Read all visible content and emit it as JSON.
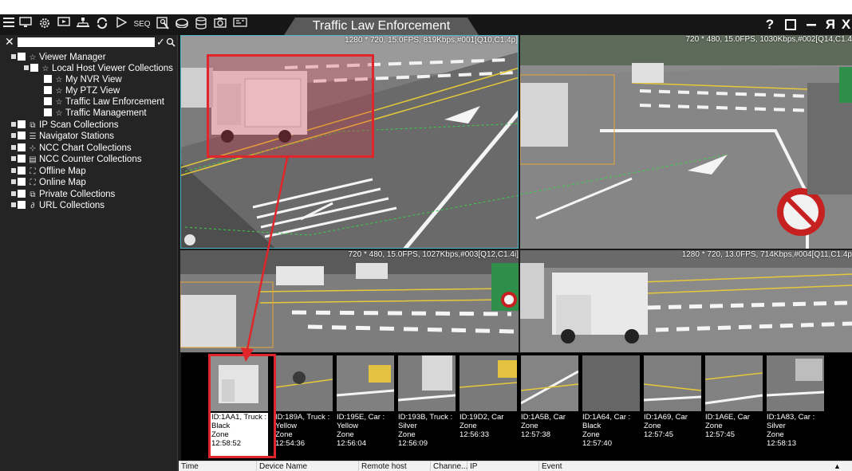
{
  "toolbar": {
    "icons": [
      "hamburger-menu-icon",
      "monitor-icon",
      "gear-icon",
      "display-icon",
      "network-icon",
      "refresh-icon",
      "play-icon",
      "sequence-icon",
      "map-pin-icon",
      "storage-icon",
      "database-icon",
      "snapshot-icon",
      "capture-icon"
    ],
    "seq_label": "SEQ"
  },
  "window": {
    "title": "Traffic Law Enforcement",
    "help": "?",
    "maximize": "☐",
    "minimize": "−",
    "user": "Я",
    "close": "X"
  },
  "sidebar": {
    "search_placeholder": "",
    "tree": [
      {
        "label": "Viewer Manager",
        "icon": "star-icon"
      },
      {
        "label": "Local Host Viewer Collections",
        "icon": "star-icon"
      },
      {
        "label": "My NVR View",
        "icon": "star-icon"
      },
      {
        "label": "My PTZ View",
        "icon": "star-icon"
      },
      {
        "label": "Traffic Law Enforcement",
        "icon": "star-icon"
      },
      {
        "label": "Traffic Management",
        "icon": "star-icon"
      },
      {
        "label": "IP Scan Collections",
        "icon": "ip-scan-icon"
      },
      {
        "label": "Navigator Stations",
        "icon": "station-icon"
      },
      {
        "label": "NCC Chart Collections",
        "icon": "chart-icon"
      },
      {
        "label": "NCC Counter Collections",
        "icon": "counter-icon"
      },
      {
        "label": "Offline Map",
        "icon": "map-icon"
      },
      {
        "label": "Online Map",
        "icon": "map-icon"
      },
      {
        "label": "Private Collections",
        "icon": "private-icon"
      },
      {
        "label": "URL Collections",
        "icon": "link-icon"
      }
    ]
  },
  "cameras": [
    {
      "info": "1280 * 720, 15.0FPS, 819Kbps,#001[Q10,C1.4p]"
    },
    {
      "info": "720 * 480, 15.0FPS, 1030Kbps,#002[Q14,C1.4"
    },
    {
      "info": "720 * 480, 15.0FPS, 1027Kbps,#003[Q12,C1.4i]"
    },
    {
      "info": "1280 * 720, 13.0FPS, 714Kbps,#004[Q11,C1.4p"
    }
  ],
  "thumbnails": [
    {
      "lines": [
        "ID:1AA1, Truck :",
        "Black",
        "Zone",
        "12:58:52"
      ],
      "selected": true
    },
    {
      "lines": [
        "ID:189A, Truck :",
        "Yellow",
        "Zone",
        "12:54:36"
      ]
    },
    {
      "lines": [
        "ID:195E, Car :",
        "Yellow",
        "Zone",
        "12:56:04"
      ]
    },
    {
      "lines": [
        "ID:193B, Truck :",
        "Silver",
        "Zone",
        "12:56:09"
      ]
    },
    {
      "lines": [
        "ID:19D2, Car",
        "Zone",
        "12:56:33"
      ]
    },
    {
      "lines": [
        "ID:1A5B, Car",
        "Zone",
        "12:57:38"
      ]
    },
    {
      "lines": [
        "ID:1A64, Car :",
        "Black",
        "Zone",
        "12:57:40"
      ]
    },
    {
      "lines": [
        "ID:1A69, Car",
        "Zone",
        "12:57:45"
      ]
    },
    {
      "lines": [
        "ID:1A6E, Car",
        "Zone",
        "12:57:45"
      ]
    },
    {
      "lines": [
        "ID:1A83, Car :",
        "Silver",
        "Zone",
        "12:58:13"
      ]
    }
  ],
  "events": {
    "columns": [
      "Time",
      "Device Name",
      "Remote host",
      "Channe...",
      "IP",
      "Event"
    ]
  },
  "colors": {
    "highlight": "#e0262a",
    "selected_pane": "#4fb3c8"
  }
}
